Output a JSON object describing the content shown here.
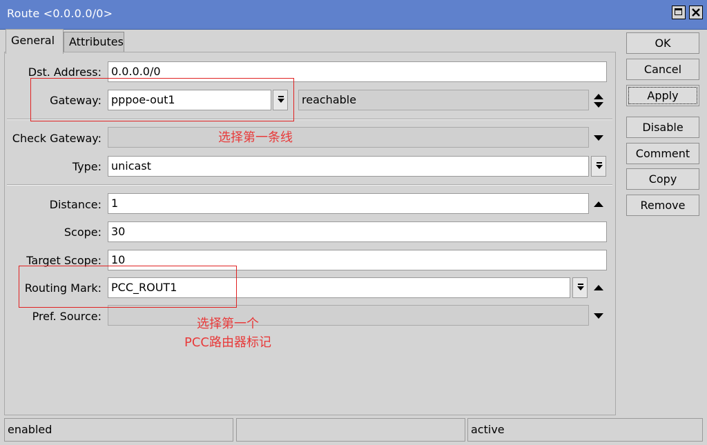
{
  "window": {
    "title": "Route <0.0.0.0/0>"
  },
  "tabs": [
    {
      "label": "General"
    },
    {
      "label": "Attributes"
    }
  ],
  "form": {
    "dst_address": {
      "label": "Dst. Address:",
      "value": "0.0.0.0/0"
    },
    "gateway": {
      "label": "Gateway:",
      "value": "pppoe-out1",
      "status": "reachable"
    },
    "check_gateway": {
      "label": "Check Gateway:",
      "value": ""
    },
    "type": {
      "label": "Type:",
      "value": "unicast"
    },
    "distance": {
      "label": "Distance:",
      "value": "1"
    },
    "scope": {
      "label": "Scope:",
      "value": "30"
    },
    "target_scope": {
      "label": "Target Scope:",
      "value": "10"
    },
    "routing_mark": {
      "label": "Routing Mark:",
      "value": "PCC_ROUT1"
    },
    "pref_source": {
      "label": "Pref. Source:",
      "value": ""
    }
  },
  "buttons": {
    "ok": "OK",
    "cancel": "Cancel",
    "apply": "Apply",
    "disable": "Disable",
    "comment": "Comment",
    "copy": "Copy",
    "remove": "Remove"
  },
  "annotations": {
    "gateway_note": "选择第一条线",
    "routing_mark_note_line1": "选择第一个",
    "routing_mark_note_line2": "PCC路由器标记"
  },
  "status_bar": {
    "left": "enabled",
    "middle": "",
    "right": "active"
  },
  "colors": {
    "title_bar": "#5f81cc",
    "annotation": "#e02020"
  },
  "icons": [
    "maximize-icon",
    "close-icon",
    "dropdown-icon",
    "triangle-down-icon",
    "triangle-up-icon",
    "up-down-arrows-icon"
  ]
}
